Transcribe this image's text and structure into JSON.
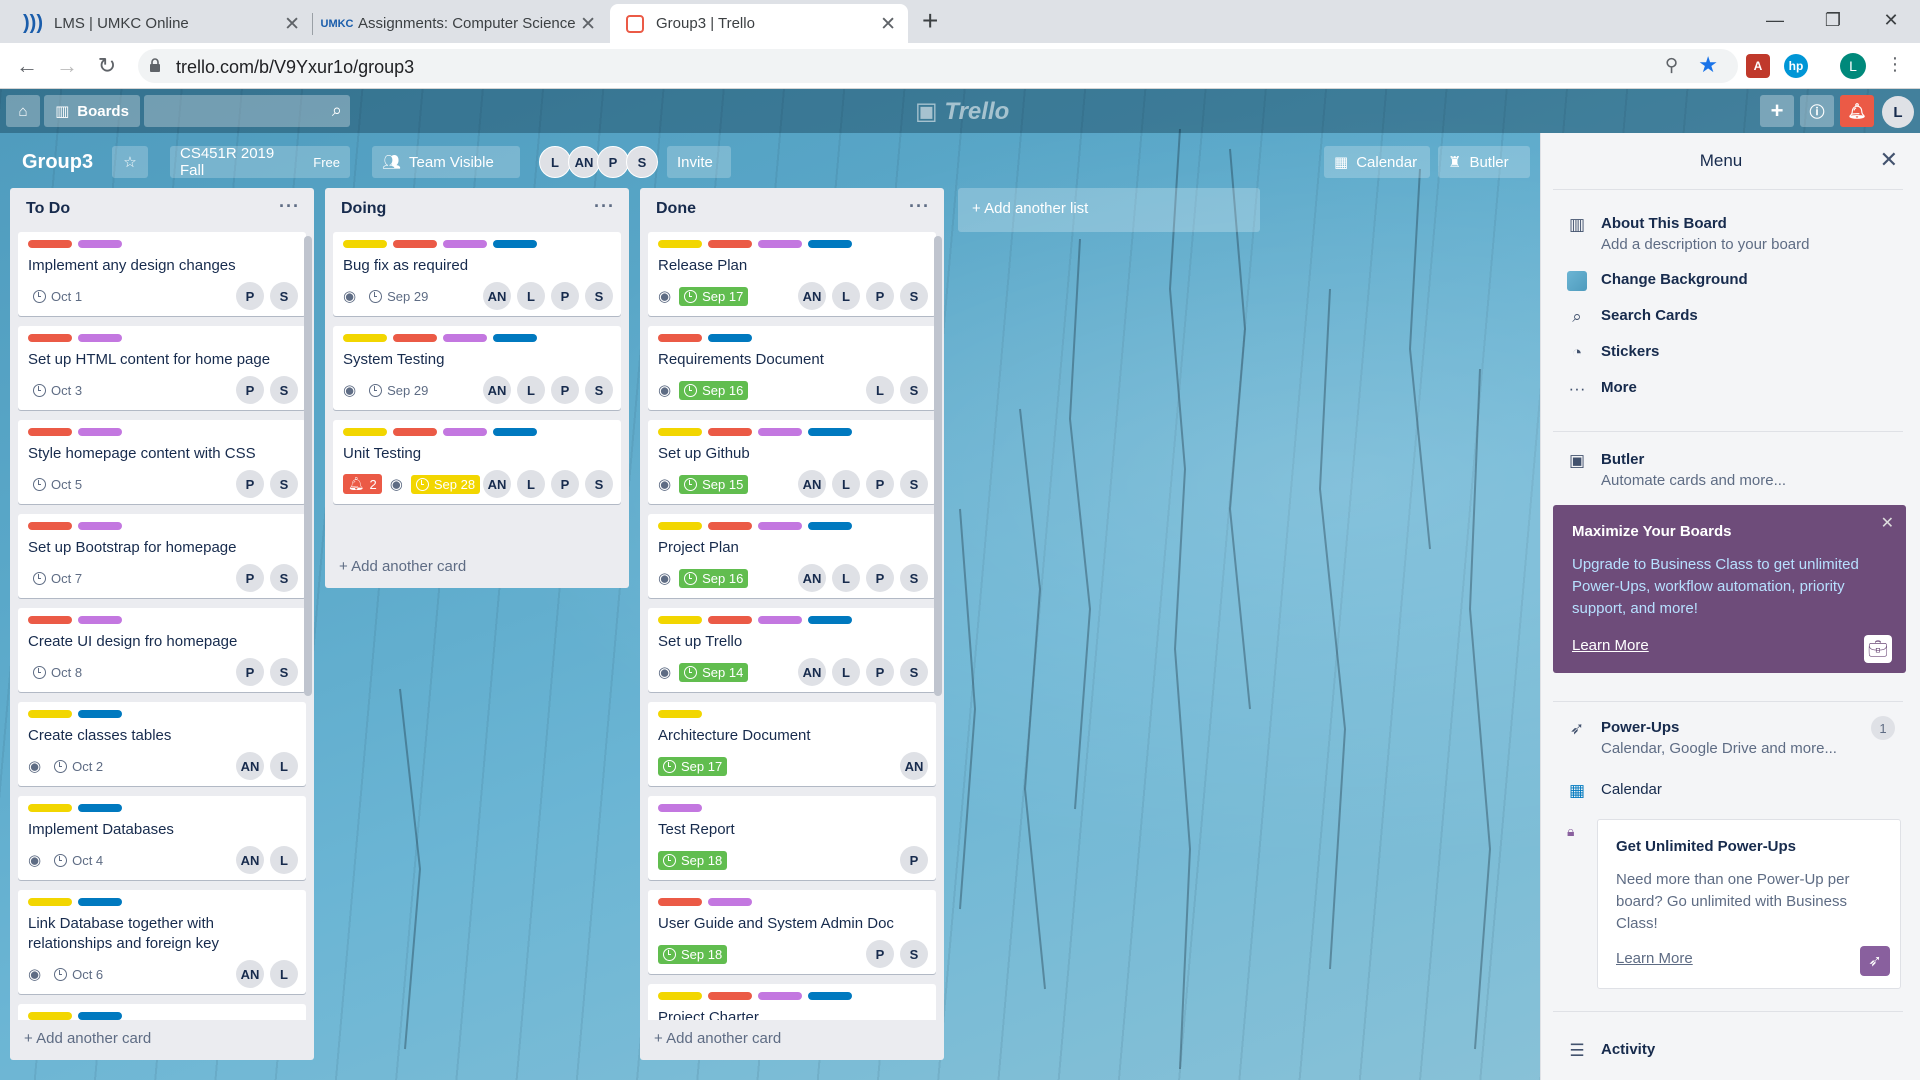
{
  "browser": {
    "tabs": [
      {
        "title": "LMS | UMKC Online",
        "icon": "umkc-lms-icon"
      },
      {
        "title": "Assignments: Computer Science",
        "icon": "umkc-icon"
      },
      {
        "title": "Group3 | Trello",
        "icon": "trello-icon",
        "active": true
      }
    ],
    "url": "trello.com/b/V9Yxur1o/group3",
    "profile_initial": "L"
  },
  "topbar": {
    "boards_label": "Boards",
    "logo": "Trello",
    "user_initial": "L"
  },
  "board": {
    "title": "Group3",
    "team": "CS451R 2019 Fall",
    "plan": "Free",
    "visibility": "Team Visible",
    "members": [
      "L",
      "AN",
      "P",
      "S"
    ],
    "invite_label": "Invite",
    "calendar_label": "Calendar",
    "butler_label": "Butler",
    "add_list_label": "+ Add another list"
  },
  "label_colors": {
    "green": "#61bd4f",
    "yellow": "#f2d600",
    "red": "#eb5a46",
    "purple": "#c377e0",
    "blue": "#0079bf"
  },
  "lists": [
    {
      "name": "To Do",
      "add_card": "Add another card",
      "cards": [
        {
          "labels": [
            "red",
            "purple"
          ],
          "title": "Implement any design changes",
          "watch": false,
          "due": "Oct 1",
          "due_style": "plain",
          "members": [
            "P",
            "S"
          ]
        },
        {
          "labels": [
            "red",
            "purple"
          ],
          "title": "Set up HTML content for home page",
          "watch": false,
          "due": "Oct 3",
          "due_style": "plain",
          "members": [
            "P",
            "S"
          ]
        },
        {
          "labels": [
            "red",
            "purple"
          ],
          "title": "Style homepage content with CSS",
          "watch": false,
          "due": "Oct 5",
          "due_style": "plain",
          "members": [
            "P",
            "S"
          ]
        },
        {
          "labels": [
            "red",
            "purple"
          ],
          "title": "Set up Bootstrap for homepage",
          "watch": false,
          "due": "Oct 7",
          "due_style": "plain",
          "members": [
            "P",
            "S"
          ]
        },
        {
          "labels": [
            "red",
            "purple"
          ],
          "title": "Create UI design fro homepage",
          "watch": false,
          "due": "Oct 8",
          "due_style": "plain",
          "members": [
            "P",
            "S"
          ]
        },
        {
          "labels": [
            "yellow",
            "blue"
          ],
          "title": "Create classes tables",
          "watch": true,
          "due": "Oct 2",
          "due_style": "plain",
          "members": [
            "AN",
            "L"
          ]
        },
        {
          "labels": [
            "yellow",
            "blue"
          ],
          "title": "Implement Databases",
          "watch": true,
          "due": "Oct 4",
          "due_style": "plain",
          "members": [
            "AN",
            "L"
          ]
        },
        {
          "labels": [
            "yellow",
            "blue"
          ],
          "title": "Link Database together with relationships and foreign key",
          "watch": true,
          "due": "Oct 6",
          "due_style": "plain",
          "members": [
            "AN",
            "L"
          ]
        },
        {
          "labels": [
            "yellow",
            "blue"
          ],
          "title": "",
          "watch": false,
          "due": "",
          "due_style": "plain",
          "members": []
        }
      ]
    },
    {
      "name": "Doing",
      "add_card": "Add another card",
      "cards": [
        {
          "labels": [
            "yellow",
            "red",
            "purple",
            "blue"
          ],
          "title": "Bug fix as required",
          "watch": true,
          "due": "Sep 29",
          "due_style": "plain",
          "members": [
            "AN",
            "L",
            "P",
            "S"
          ]
        },
        {
          "labels": [
            "yellow",
            "red",
            "purple",
            "blue"
          ],
          "title": "System Testing",
          "watch": true,
          "due": "Sep 29",
          "due_style": "plain",
          "members": [
            "AN",
            "L",
            "P",
            "S"
          ]
        },
        {
          "labels": [
            "yellow",
            "red",
            "purple",
            "blue"
          ],
          "title": "Unit Testing",
          "alert": "2",
          "watch": true,
          "due": "Sep 28",
          "due_style": "yellow",
          "members": [
            "AN",
            "L",
            "P",
            "S"
          ]
        }
      ]
    },
    {
      "name": "Done",
      "add_card": "Add another card",
      "cards": [
        {
          "labels": [
            "yellow",
            "red",
            "purple",
            "blue"
          ],
          "title": "Release Plan",
          "watch": true,
          "due": "Sep 17",
          "due_style": "green",
          "members": [
            "AN",
            "L",
            "P",
            "S"
          ]
        },
        {
          "labels": [
            "red",
            "blue"
          ],
          "title": "Requirements Document",
          "watch": true,
          "due": "Sep 16",
          "due_style": "green",
          "members": [
            "L",
            "S"
          ]
        },
        {
          "labels": [
            "yellow",
            "red",
            "purple",
            "blue"
          ],
          "title": "Set up Github",
          "watch": true,
          "due": "Sep 15",
          "due_style": "green",
          "members": [
            "AN",
            "L",
            "P",
            "S"
          ]
        },
        {
          "labels": [
            "yellow",
            "red",
            "purple",
            "blue"
          ],
          "title": "Project Plan",
          "watch": true,
          "due": "Sep 16",
          "due_style": "green",
          "members": [
            "AN",
            "L",
            "P",
            "S"
          ]
        },
        {
          "labels": [
            "yellow",
            "red",
            "purple",
            "blue"
          ],
          "title": "Set up Trello",
          "watch": true,
          "due": "Sep 14",
          "due_style": "green",
          "members": [
            "AN",
            "L",
            "P",
            "S"
          ]
        },
        {
          "labels": [
            "yellow"
          ],
          "title": "Architecture Document",
          "watch": false,
          "due": "Sep 17",
          "due_style": "green",
          "members": [
            "AN"
          ]
        },
        {
          "labels": [
            "purple"
          ],
          "title": "Test Report",
          "watch": false,
          "due": "Sep 18",
          "due_style": "green",
          "members": [
            "P"
          ]
        },
        {
          "labels": [
            "red",
            "purple"
          ],
          "title": "User Guide and System Admin Doc",
          "watch": false,
          "due": "Sep 18",
          "due_style": "green",
          "members": [
            "P",
            "S"
          ]
        },
        {
          "labels": [
            "yellow",
            "red",
            "purple",
            "blue"
          ],
          "title": "Project Charter",
          "watch": false,
          "due": "",
          "due_style": "plain",
          "members": []
        }
      ]
    }
  ],
  "menu": {
    "title": "Menu",
    "about_title": "About This Board",
    "about_sub": "Add a description to your board",
    "change_bg": "Change Background",
    "search_cards": "Search Cards",
    "stickers": "Stickers",
    "more": "More",
    "butler_title": "Butler",
    "butler_sub": "Automate cards and more...",
    "promo_title": "Maximize Your Boards",
    "promo_text": "Upgrade to Business Class to get unlimited Power-Ups, workflow automation, priority support, and more!",
    "promo_link": "Learn More",
    "powerups_title": "Power-Ups",
    "powerups_sub": "Calendar, Google Drive and more...",
    "powerups_count": "1",
    "calendar": "Calendar",
    "upsell_title": "Get Unlimited Power-Ups",
    "upsell_text": "Need more than one Power-Up per board? Go unlimited with Business Class!",
    "upsell_link": "Learn More",
    "activity": "Activity"
  }
}
